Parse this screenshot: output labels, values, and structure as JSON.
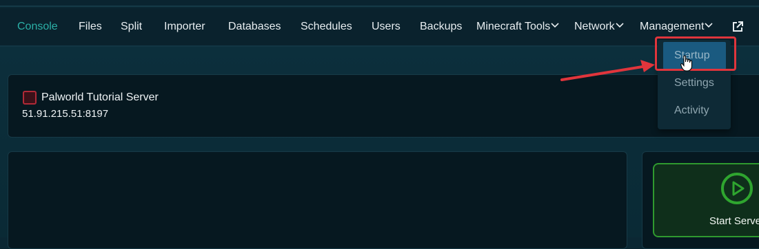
{
  "nav": {
    "items": [
      {
        "label": "Console",
        "active": true
      },
      {
        "label": "Files"
      },
      {
        "label": "Split"
      },
      {
        "label": "Importer"
      },
      {
        "label": "Databases"
      },
      {
        "label": "Schedules"
      },
      {
        "label": "Users"
      },
      {
        "label": "Backups"
      },
      {
        "label": "Minecraft Tools",
        "has_dropdown": true
      },
      {
        "label": "Network",
        "has_dropdown": true
      },
      {
        "label": "Management",
        "has_dropdown": true
      }
    ],
    "external_link_icon": "external-link-icon"
  },
  "management_menu": {
    "items": [
      {
        "label": "Startup",
        "highlighted": true
      },
      {
        "label": "Settings"
      },
      {
        "label": "Activity"
      }
    ]
  },
  "server": {
    "name": "Palworld Tutorial Server",
    "address": "51.91.215.51:8197",
    "status_color": "#b02a37"
  },
  "controls": {
    "start_label": "Start Server",
    "start_icon": "play-circle-icon",
    "start_color": "#2f9a2f"
  },
  "annotation": {
    "highlight_color": "#e0353c"
  },
  "colors": {
    "accent": "#2bb0a7",
    "background": "#0b2733"
  }
}
